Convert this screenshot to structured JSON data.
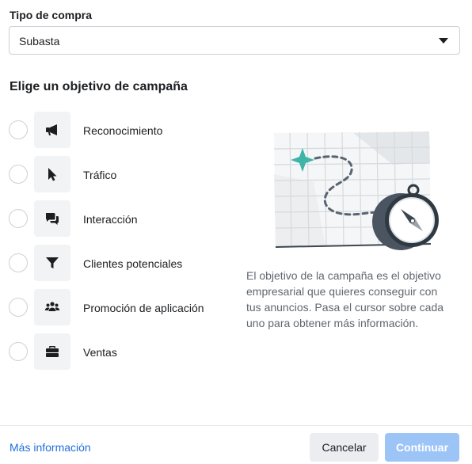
{
  "purchase_type": {
    "label": "Tipo de compra",
    "selected": "Subasta"
  },
  "objectives_section": {
    "title": "Elige un objetivo de campaña",
    "items": [
      {
        "label": "Reconocimiento",
        "icon": "megaphone-icon"
      },
      {
        "label": "Tráfico",
        "icon": "cursor-icon"
      },
      {
        "label": "Interacción",
        "icon": "chat-bubbles-icon"
      },
      {
        "label": "Clientes potenciales",
        "icon": "funnel-icon"
      },
      {
        "label": "Promoción de aplicación",
        "icon": "people-group-icon"
      },
      {
        "label": "Ventas",
        "icon": "briefcase-icon"
      }
    ],
    "description": "El objetivo de la campaña es el objetivo empresarial que quieres conseguir con tus anuncios. Pasa el cursor sobre cada uno para obtener más información."
  },
  "footer": {
    "more_info": "Más información",
    "cancel": "Cancelar",
    "continue": "Continuar"
  },
  "colors": {
    "link": "#216fdb",
    "primary_disabled": "#9cc4f7",
    "accent_teal": "#3fb5a8"
  }
}
